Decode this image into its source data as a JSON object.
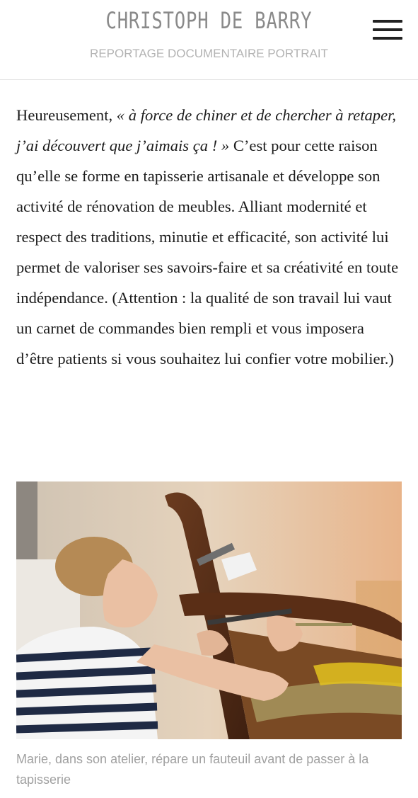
{
  "header": {
    "site_title": "CHRISTOPH DE BARRY",
    "site_subtitle": "REPORTAGE DOCUMENTAIRE PORTRAIT",
    "menu_icon": "hamburger-menu-icon"
  },
  "article": {
    "text_before_quote": "Heureusement, ",
    "quote": "« à force de chiner et de chercher à retaper, j’ai découvert que j’aimais ça ! »",
    "text_after_quote": " C’est pour cette raison qu’elle se forme en tapisserie artisanale et développe son activité de rénovation de meubles. Alliant modernité et respect des traditions, minutie et efficacité, son activité lui permet de valoriser ses savoirs-faire et sa créativité en toute indépendance. (Attention : la qualité de son travail lui vaut un carnet de commandes bien rempli et vous imposera d’être patients si vous souhaitez lui confier votre mobilier.)"
  },
  "figure": {
    "caption": "Marie, dans son atelier, répare un fauteuil avant de passer à la tapisserie"
  }
}
